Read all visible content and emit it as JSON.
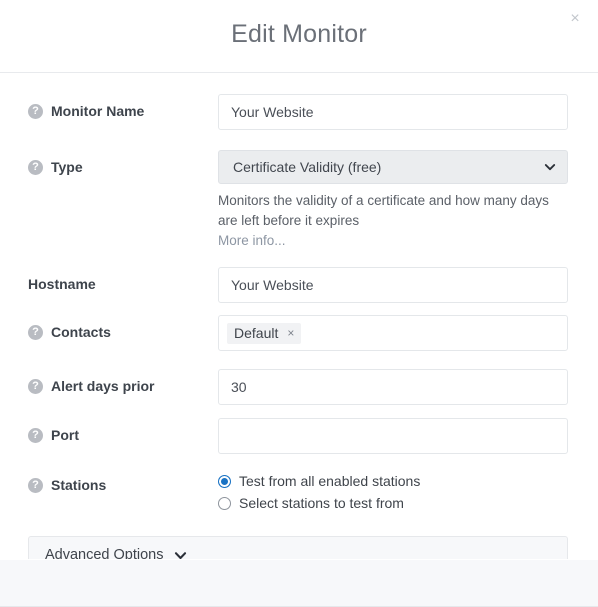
{
  "modal": {
    "title": "Edit Monitor",
    "close_label": "×",
    "close_icon": "close-icon"
  },
  "fields": {
    "monitor_name": {
      "label": "Monitor Name",
      "help_icon": "?",
      "value": "Your Website",
      "placeholder": ""
    },
    "type": {
      "label": "Type",
      "help_icon": "?",
      "value": "Certificate Validity (free)",
      "description": "Monitors the validity of a certificate and how many days are left before it expires",
      "more_info_label": "More info..."
    },
    "hostname": {
      "label": "Hostname",
      "value": "Your Website",
      "placeholder": ""
    },
    "contacts": {
      "label": "Contacts",
      "help_icon": "?",
      "tags": [
        {
          "label": "Default",
          "remove_label": "×"
        }
      ]
    },
    "alert_days_prior": {
      "label": "Alert days prior",
      "help_icon": "?",
      "value": "30",
      "placeholder": ""
    },
    "port": {
      "label": "Port",
      "help_icon": "?",
      "value": "",
      "placeholder": ""
    },
    "stations": {
      "label": "Stations",
      "help_icon": "?",
      "options": [
        {
          "label": "Test from all enabled stations",
          "selected": true
        },
        {
          "label": "Select stations to test from",
          "selected": false
        }
      ]
    }
  },
  "advanced": {
    "label": "Advanced Options",
    "chevron_icon": "chevron-down-icon"
  },
  "colors": {
    "accent": "#1a73c4",
    "title_text": "#6b7078",
    "label_text": "#3e444c",
    "panel_bg": "#f7f8fa",
    "select_bg": "#ebedef",
    "border": "#e4e7ea"
  }
}
